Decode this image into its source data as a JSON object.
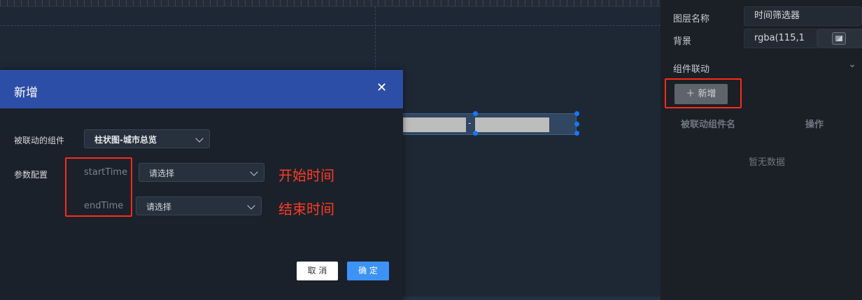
{
  "panel": {
    "layer_name_label": "图层名称",
    "layer_name_value": "时间筛选器",
    "background_label": "背景",
    "background_value": "rgba(115,1",
    "linkage_section_label": "组件联动",
    "linkage_chevron": "⌄",
    "add_button_label": "＋ 新增",
    "table_headers": [
      "被联动组件名",
      "操作"
    ],
    "empty_text": "暂无数据"
  },
  "canvas": {
    "widget_separator": "-"
  },
  "dialog": {
    "title": "新增",
    "close_glyph": "✕",
    "linked_component_label": "被联动的组件",
    "linked_component_value": "柱状图-城市总览",
    "param_config_label": "参数配置",
    "params": [
      {
        "name": "startTime",
        "placeholder": "请选择",
        "note": "开始时间"
      },
      {
        "name": "endTime",
        "placeholder": "请选择",
        "note": "结束时间"
      }
    ],
    "cancel_label": "取 消",
    "confirm_label": "确 定"
  },
  "colors": {
    "dialog_header": "#2c4ea6",
    "primary_button": "#3d92f5",
    "annotation_red": "#ff2a1a",
    "canvas_bg": "#1e2835",
    "panel_bg": "#1b1f26"
  },
  "icons": {
    "close": "close-icon",
    "dropdown": "chevron-down-icon",
    "color_picker": "color-swatch-icon",
    "add": "plus-icon"
  }
}
